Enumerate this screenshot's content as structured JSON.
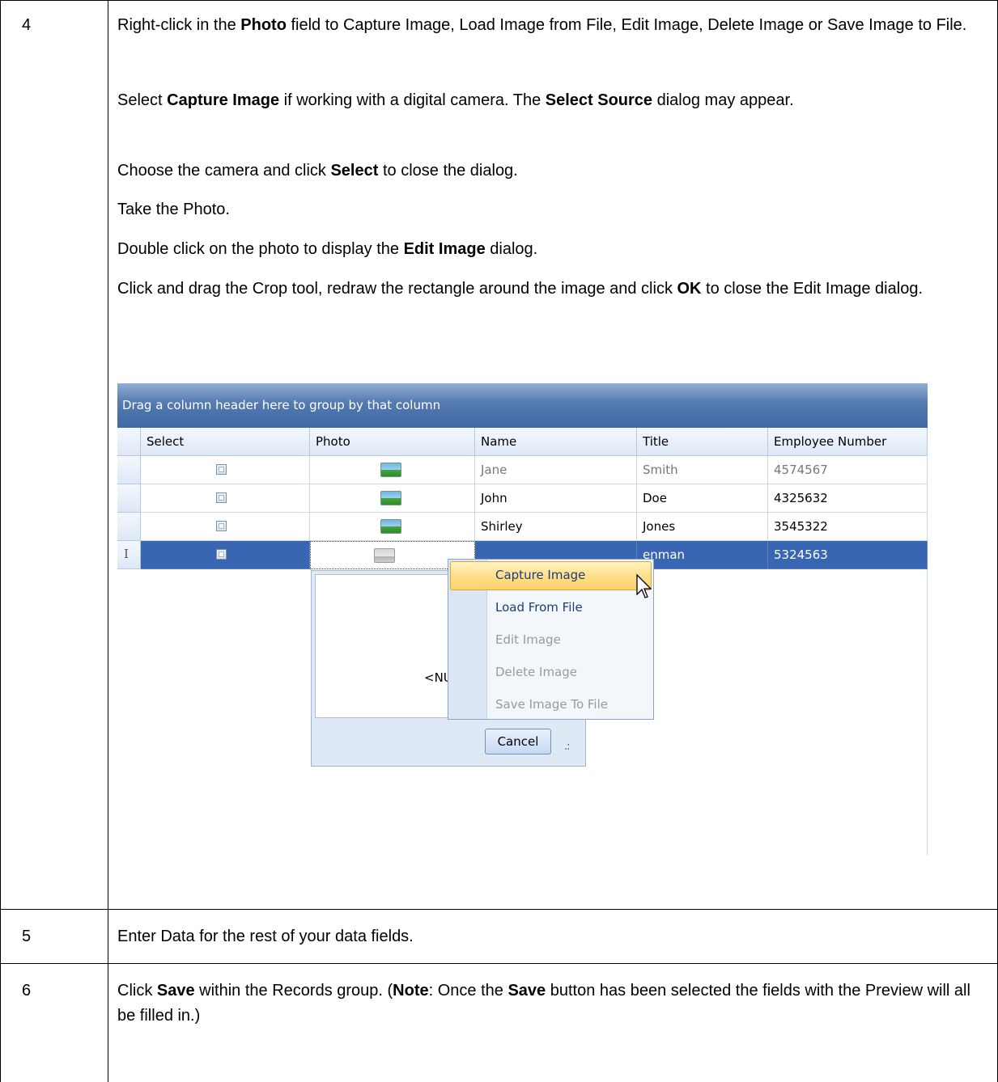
{
  "steps": [
    {
      "number": "4",
      "paragraphs": [
        [
          "Right-click in the ",
          {
            "b": "Photo"
          },
          " field to Capture Image, Load Image from File, Edit Image, Delete Image or Save Image to File."
        ],
        [
          "Select ",
          {
            "b": "Capture Image"
          },
          " if working with a digital camera. The ",
          {
            "b": "Select Source"
          },
          " dialog may appear."
        ],
        [
          "Choose the camera and click ",
          {
            "b": "Select"
          },
          " to close the dialog."
        ],
        [
          "Take the Photo."
        ],
        [
          "Double click on the photo to display the ",
          {
            "b": "Edit Image"
          },
          " dialog."
        ],
        [
          "Click and drag the Crop tool, redraw the rectangle around the image and click ",
          {
            "b": "OK"
          },
          " to close the Edit Image dialog."
        ]
      ]
    },
    {
      "number": "5",
      "paragraphs": [
        [
          "Enter Data for the rest of your data fields."
        ]
      ]
    },
    {
      "number": "6",
      "paragraphs": [
        [
          "Click ",
          {
            "b": "Save"
          },
          " within the Records group. (",
          {
            "b": "Note"
          },
          ": Once the ",
          {
            "b": "Save"
          },
          " button has been selected the fields with the Preview will all be filled in.)"
        ]
      ]
    }
  ],
  "grid": {
    "group_panel_text": "Drag a column header here to group by that column",
    "columns": [
      "Select",
      "Photo",
      "Name",
      "Title",
      "Employee Number"
    ],
    "rows": [
      {
        "name": "Jane",
        "title": "Smith",
        "number": "4574567"
      },
      {
        "name": "John",
        "title": "Doe",
        "number": "4325632"
      },
      {
        "name": "Shirley",
        "title": "Jones",
        "number": "3545322"
      },
      {
        "name": "",
        "title": "enman",
        "number": "5324563"
      }
    ],
    "row_indicator": "I",
    "popup": {
      "null_text": "<NU",
      "cancel_label": "Cancel",
      "grip": ".:"
    },
    "context_menu": [
      {
        "label": "Capture Image",
        "enabled": true,
        "highlighted": true
      },
      {
        "label": "Load From File",
        "enabled": true
      },
      {
        "label": "Edit Image",
        "enabled": false
      },
      {
        "label": "Delete Image",
        "enabled": false
      },
      {
        "label": "Save Image To File",
        "enabled": false
      }
    ]
  }
}
